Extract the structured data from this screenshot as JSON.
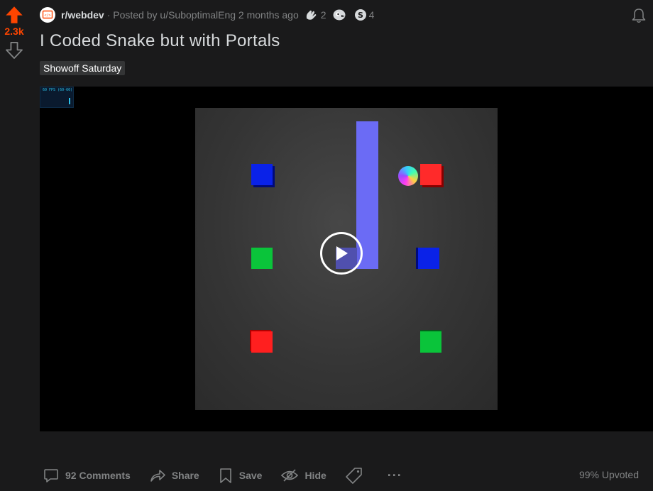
{
  "vote": {
    "score": "2.3k",
    "upvote_icon": "upvote-arrow-icon",
    "downvote_icon": "downvote-arrow-icon",
    "upvote_color": "#ff4500"
  },
  "meta": {
    "subreddit": "r/webdev",
    "posted_by": "· Posted by u/SuboptimalEng 2 months ago",
    "awards": [
      {
        "icon": "hands-award-icon",
        "count": "2"
      },
      {
        "icon": "bird-award-icon",
        "count": ""
      },
      {
        "icon": "silver-award-icon",
        "count": "4"
      }
    ]
  },
  "post": {
    "title": "I Coded Snake but with Portals",
    "flair": "Showoff Saturday"
  },
  "video": {
    "fps_label": "60 FPS (60-60)",
    "play_icon": "play-icon"
  },
  "actions": {
    "comments": "92 Comments",
    "share": "Share",
    "save": "Save",
    "hide": "Hide",
    "more": "···",
    "upvoted": "99% Upvoted"
  }
}
